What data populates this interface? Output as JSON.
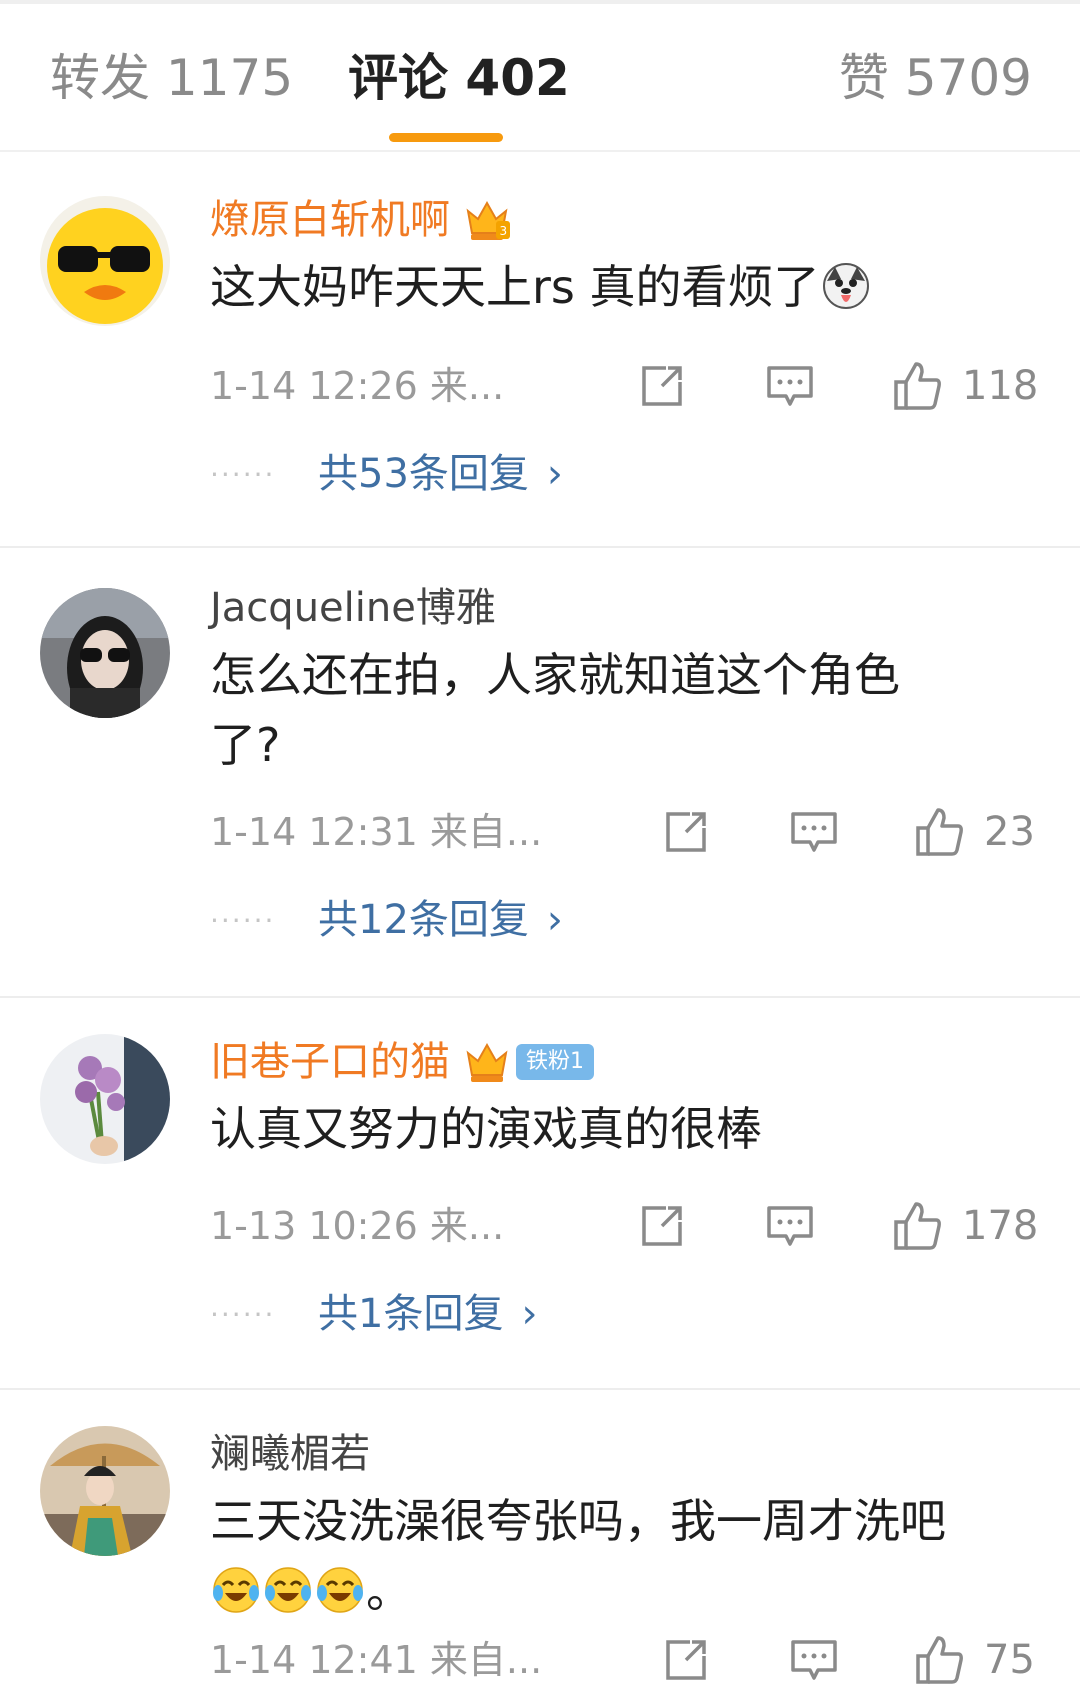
{
  "tabs": {
    "repost": "转发 1175",
    "comment": "评论 402",
    "like": "赞 5709"
  },
  "comments": [
    {
      "username": "燎原白斩机啊",
      "vip": true,
      "text": "这大妈咋天天上rs 真的看烦了",
      "emoji": "dog-tongue-emoji",
      "meta": "1-14 12:26 来...",
      "likes": "118",
      "replies": "共53条回复"
    },
    {
      "username": "Jacqueline博雅",
      "vip": false,
      "text": "怎么还在拍，人家就知道这个角色\n了?",
      "meta": "1-14 12:31 来自...",
      "likes": "23",
      "replies": "共12条回复"
    },
    {
      "username": "旧巷子口的猫",
      "vip": true,
      "fan_badge": "铁粉1",
      "text": "认真又努力的演戏真的很棒",
      "meta": "1-13 10:26 来...",
      "likes": "178",
      "replies": "共1条回复"
    },
    {
      "username": "斓曦楣若",
      "vip": false,
      "text": "三天没洗澡很夸张吗，我一周才洗吧",
      "text2": "。",
      "emoji": "crying-laughing-emoji",
      "meta": "1-14 12:41 来自...",
      "likes": "75"
    }
  ],
  "colors": {
    "accent": "#f79a0e",
    "vip_name": "#f07a23",
    "link": "#3f6fa3"
  }
}
